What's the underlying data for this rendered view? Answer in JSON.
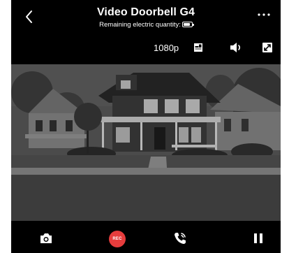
{
  "header": {
    "title": "Video Doorbell G4",
    "subtitle": "Remaining electric quantity:",
    "icons": {
      "back": "chevron-left-icon",
      "battery": "battery-icon",
      "more": "more-horizontal-icon"
    }
  },
  "toolbar": {
    "resolution": "1080p",
    "icons": [
      "sd-card-icon",
      "speaker-icon",
      "fullscreen-icon"
    ]
  },
  "controls": {
    "rec_label": "REC",
    "icons": [
      "camera-icon",
      "record-icon",
      "phone-call-icon",
      "pause-icon"
    ]
  },
  "colors": {
    "background": "#000000",
    "text": "#ffffff",
    "record": "#e63d3d"
  }
}
